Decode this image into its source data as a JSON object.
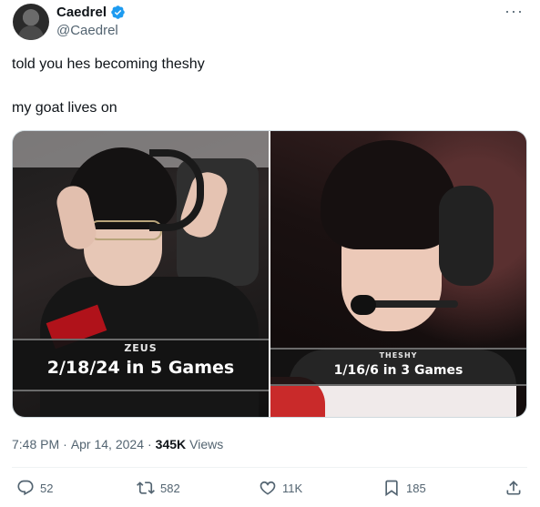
{
  "author": {
    "display_name": "Caedrel",
    "handle": "@Caedrel",
    "verified": true
  },
  "more_label": "···",
  "tweet_text": {
    "line1": "told you hes becoming theshy",
    "line2": "my goat lives on"
  },
  "media": [
    {
      "player": "ZEUS",
      "stat": "2/18/24 in 5 Games"
    },
    {
      "player": "THESHY",
      "stat": "1/16/6 in 3 Games"
    }
  ],
  "meta": {
    "time": "7:48 PM",
    "separator1": "·",
    "date": "Apr 14, 2024",
    "separator2": "·",
    "views_count": "345K",
    "views_label": "Views"
  },
  "actions": {
    "replies": "52",
    "retweets": "582",
    "likes": "11K",
    "bookmarks": "185"
  },
  "colors": {
    "verified": "#1d9bf0",
    "secondary_text": "#536471",
    "primary_text": "#0f1419"
  }
}
